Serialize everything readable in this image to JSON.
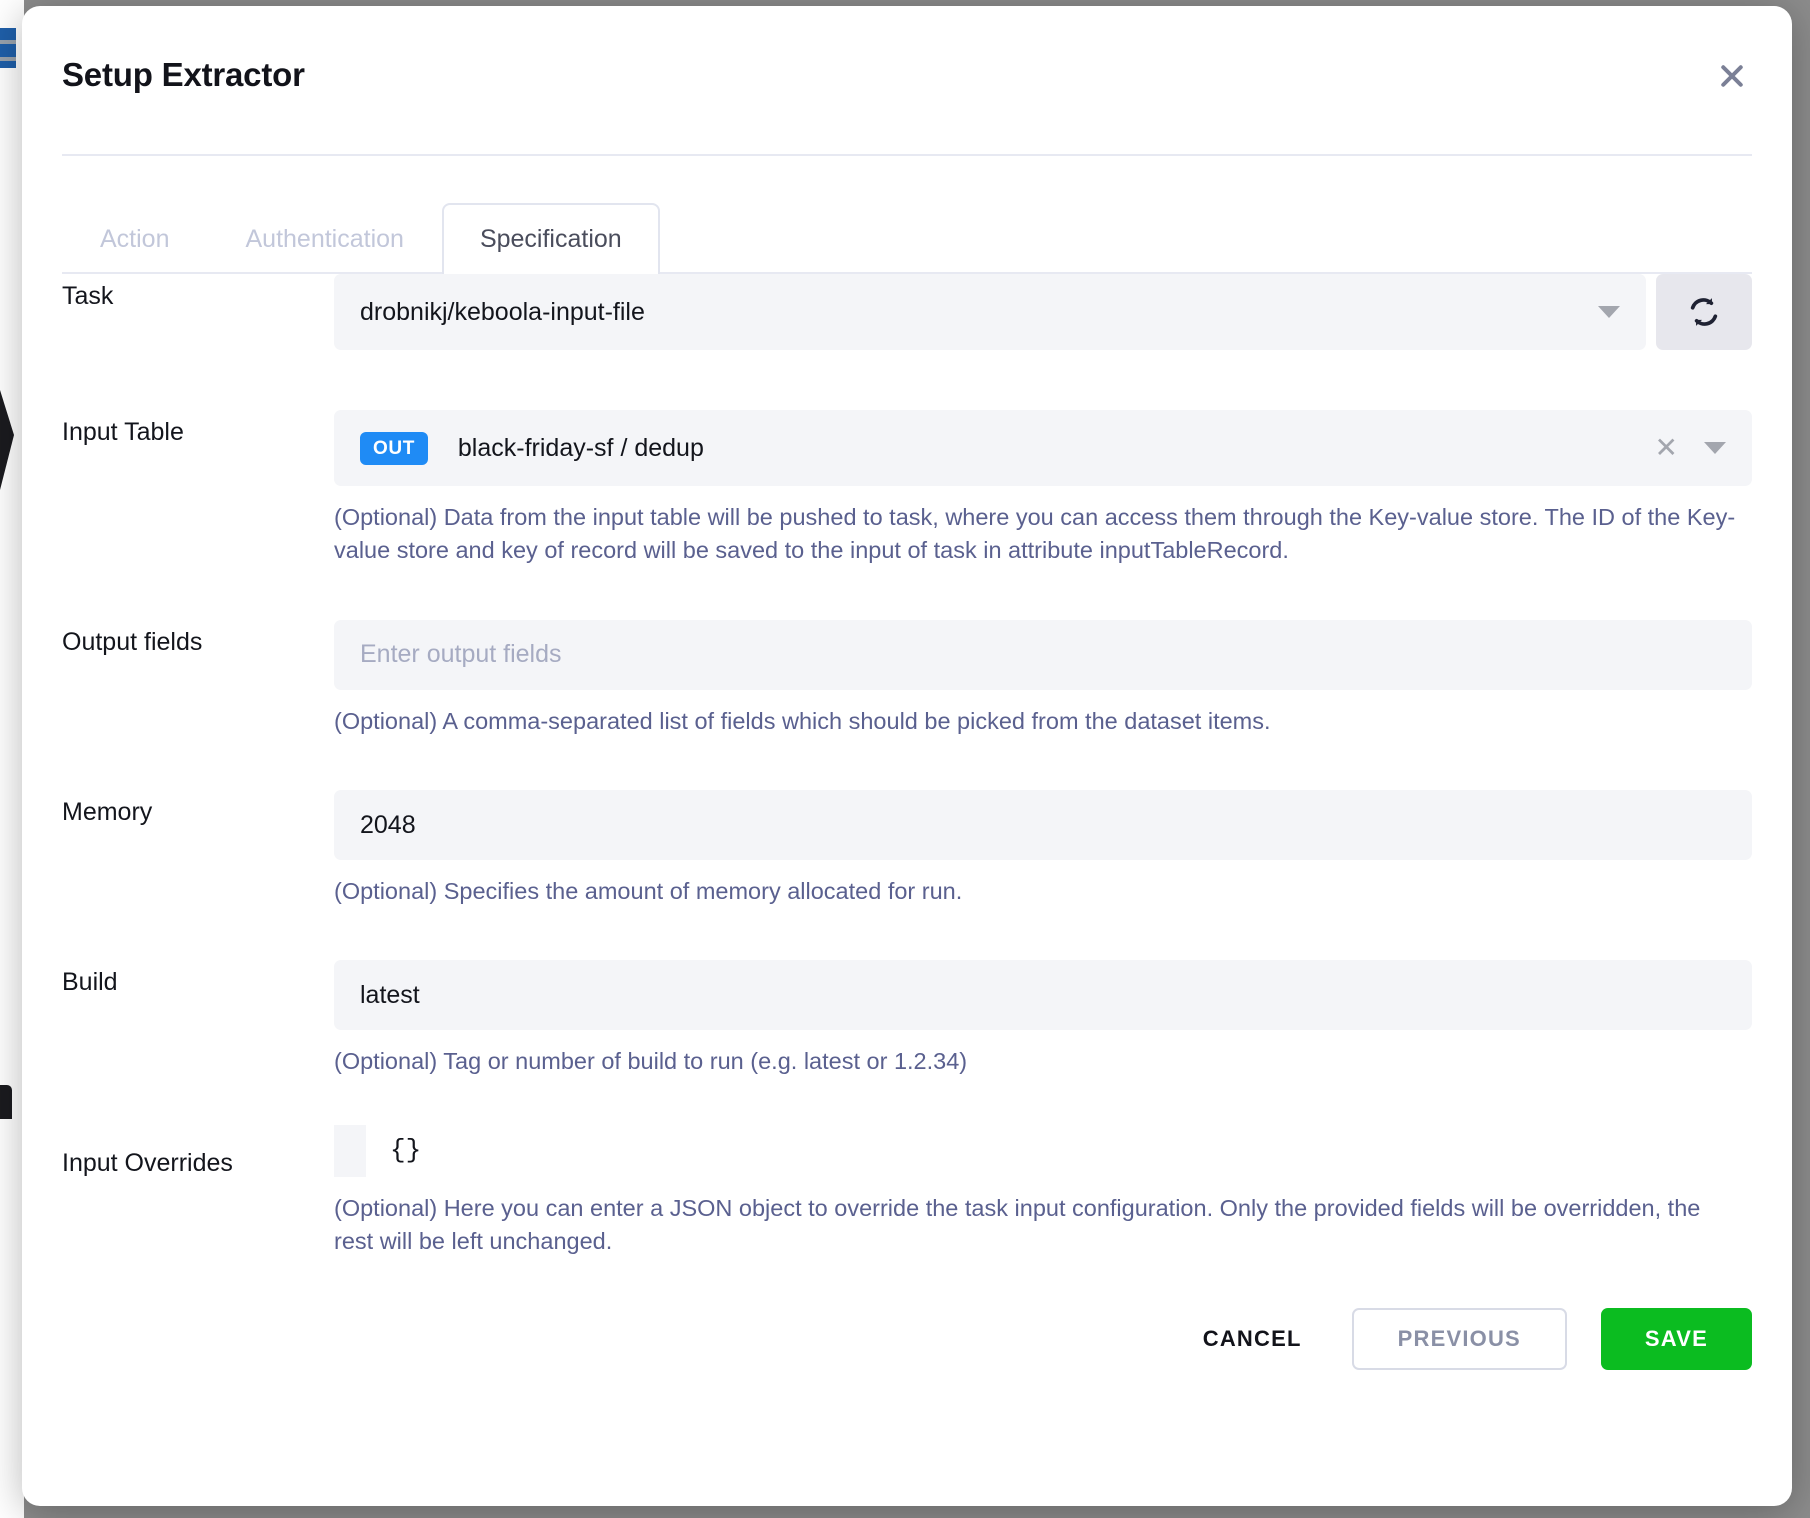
{
  "modal": {
    "title": "Setup Extractor",
    "close_icon": "close-icon"
  },
  "tabs": [
    {
      "label": "Action",
      "active": false
    },
    {
      "label": "Authentication",
      "active": false
    },
    {
      "label": "Specification",
      "active": true
    }
  ],
  "fields": {
    "task": {
      "label": "Task",
      "value": "drobnikj/keboola-input-file",
      "caret_icon": "chevron-down-icon",
      "refresh_icon": "refresh-icon"
    },
    "input_table": {
      "label": "Input Table",
      "badge": "OUT",
      "value": "black-friday-sf / dedup",
      "clear_icon": "close-icon",
      "caret_icon": "chevron-down-icon",
      "help": "(Optional) Data from the input table will be pushed to task, where you can access them through the Key-value store. The ID of the Key-value store and key of record will be saved to the input of task in attribute inputTableRecord."
    },
    "output_fields": {
      "label": "Output fields",
      "value": "",
      "placeholder": "Enter output fields",
      "help": "(Optional) A comma-separated list of fields which should be picked from the dataset items."
    },
    "memory": {
      "label": "Memory",
      "value": "2048",
      "help": "(Optional) Specifies the amount of memory allocated for run."
    },
    "build": {
      "label": "Build",
      "value": "latest",
      "help": "(Optional) Tag or number of build to run (e.g. latest or 1.2.34)"
    },
    "input_overrides": {
      "label": "Input Overrides",
      "value": "{}",
      "help": "(Optional) Here you can enter a JSON object to override the task input configuration. Only the provided fields will be overridden, the rest will be left unchanged."
    }
  },
  "footer": {
    "cancel_label": "CANCEL",
    "previous_label": "PREVIOUS",
    "save_label": "SAVE"
  },
  "colors": {
    "accent_blue": "#1f8bf5",
    "save_green": "#0bbc20",
    "help_text": "#5a608f",
    "field_bg": "#f4f5f8"
  }
}
